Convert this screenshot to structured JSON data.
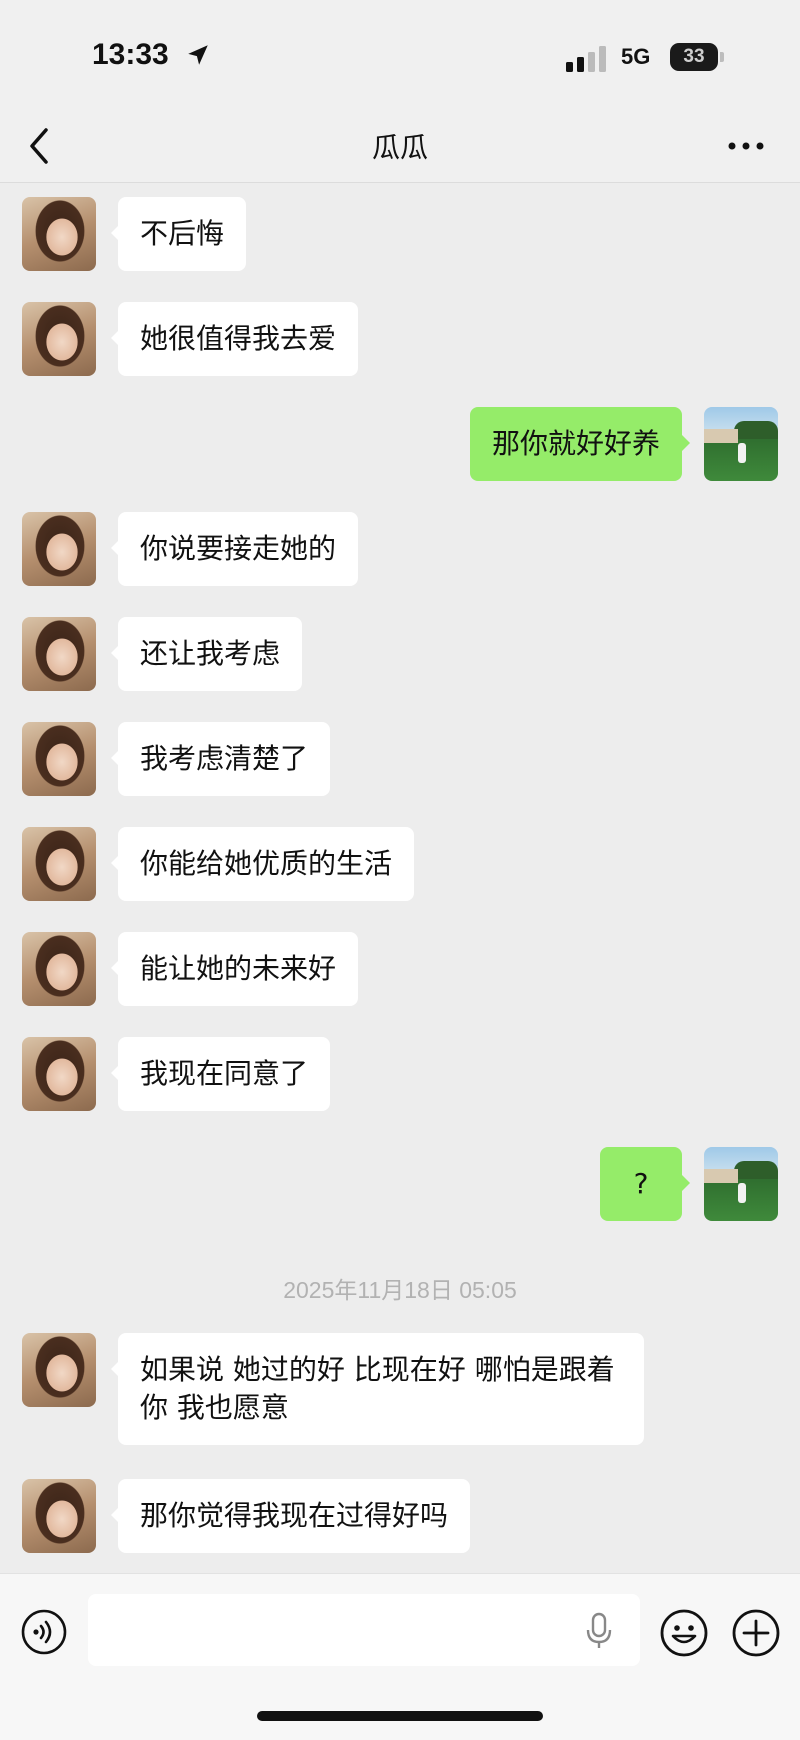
{
  "status_bar": {
    "time": "13:33",
    "network": "5G",
    "battery": "33"
  },
  "nav": {
    "title": "瓜瓜"
  },
  "messages": [
    {
      "side": "in",
      "text": "不后悔"
    },
    {
      "side": "in",
      "text": "她很值得我去爱"
    },
    {
      "side": "out",
      "text": "那你就好好养"
    },
    {
      "side": "in",
      "text": "你说要接走她的"
    },
    {
      "side": "in",
      "text": "还让我考虑"
    },
    {
      "side": "in",
      "text": "我考虑清楚了"
    },
    {
      "side": "in",
      "text": "你能给她优质的生活"
    },
    {
      "side": "in",
      "text": "能让她的未来好"
    },
    {
      "side": "in",
      "text": "我现在同意了"
    },
    {
      "side": "out",
      "text": "?"
    },
    {
      "side": "in",
      "text": "如果说 她过的好 比现在好 哪怕是跟着你 我也愿意"
    },
    {
      "side": "in",
      "text": "那你觉得我现在过得好吗"
    }
  ],
  "timestamp": "2025年11月18日 05:05",
  "input": {
    "value": ""
  },
  "icons": {
    "back": "chevron-left-icon",
    "more": "more-icon",
    "voice": "voice-icon",
    "mic": "microphone-icon",
    "emoji": "emoji-icon",
    "add": "plus-icon"
  },
  "colors": {
    "outgoing_bubble": "#95ec69",
    "incoming_bubble": "#ffffff",
    "background": "#ededed"
  }
}
